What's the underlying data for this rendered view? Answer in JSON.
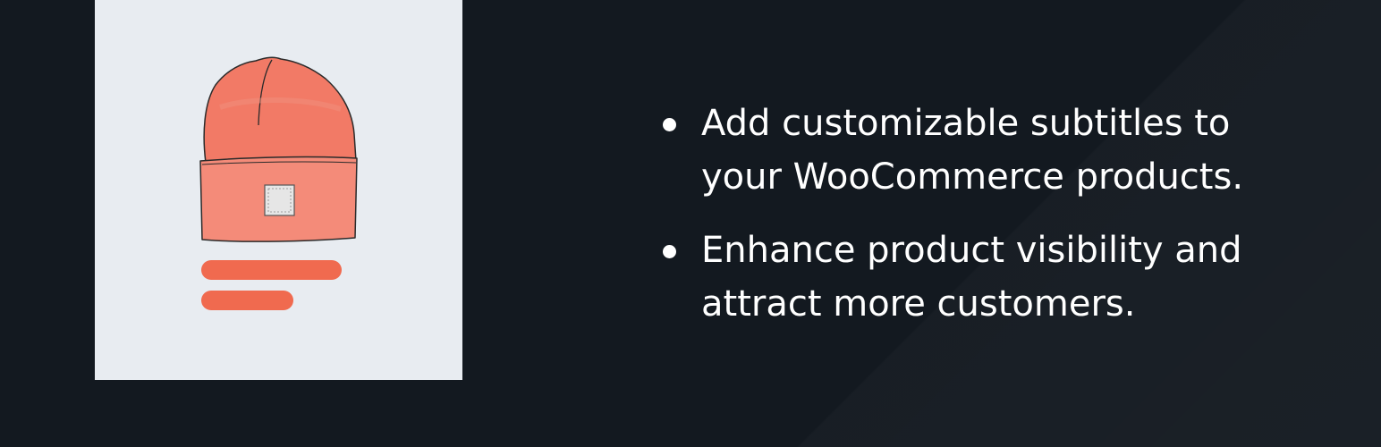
{
  "colors": {
    "background": "#131920",
    "card_background": "#e8ecf1",
    "accent": "#f06a4f",
    "beanie_fill": "#f27a66",
    "text": "#ffffff"
  },
  "illustration": {
    "icon": "beanie-hat-icon"
  },
  "features": [
    {
      "line1": "Add customizable subtitles to",
      "line2": "your WooCommerce products."
    },
    {
      "line1": "Enhance product visibility and",
      "line2": "attract more customers."
    }
  ]
}
